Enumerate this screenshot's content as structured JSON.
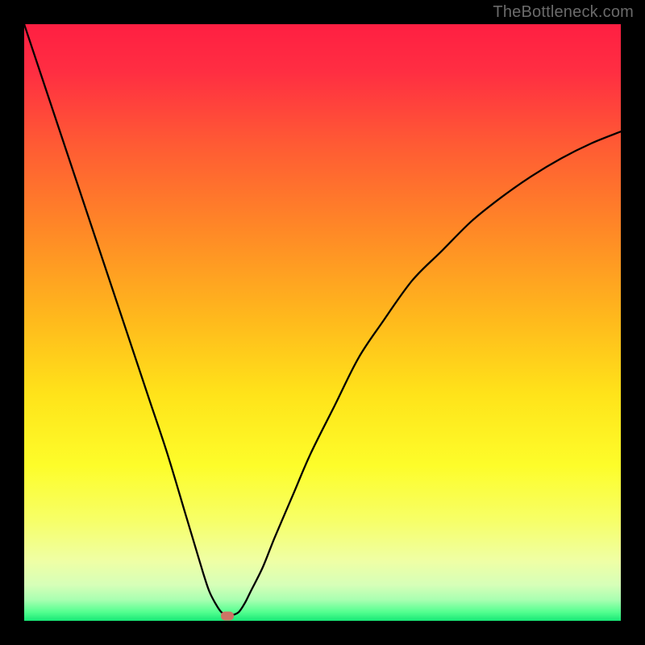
{
  "watermark": {
    "text": "TheBottleneck.com"
  },
  "chart_data": {
    "type": "line",
    "title": "",
    "xlabel": "",
    "ylabel": "",
    "xlim": [
      0,
      100
    ],
    "ylim": [
      0,
      100
    ],
    "grid": false,
    "legend": false,
    "series": [
      {
        "name": "curve",
        "x": [
          0,
          3,
          6,
          9,
          12,
          15,
          18,
          21,
          24,
          27,
          28.5,
          30,
          31,
          32,
          33,
          34,
          35,
          36,
          37,
          38,
          40,
          42,
          45,
          48,
          52,
          56,
          60,
          65,
          70,
          75,
          80,
          85,
          90,
          95,
          100
        ],
        "y": [
          100,
          91,
          82,
          73,
          64,
          55,
          46,
          37,
          28,
          18,
          13,
          8,
          5,
          3,
          1.5,
          1,
          1,
          1.5,
          3,
          5,
          9,
          14,
          21,
          28,
          36,
          44,
          50,
          57,
          62,
          67,
          71,
          74.5,
          77.5,
          80,
          82
        ],
        "color": "#000000",
        "stroke_width": 2.3
      }
    ],
    "marker": {
      "x": 34,
      "y": 0.8,
      "color": "#cd7465"
    },
    "background_gradient": {
      "stops": [
        {
          "offset": 0,
          "color": "#ff1f42"
        },
        {
          "offset": 0.08,
          "color": "#ff2e42"
        },
        {
          "offset": 0.2,
          "color": "#ff5a34"
        },
        {
          "offset": 0.35,
          "color": "#ff8a26"
        },
        {
          "offset": 0.5,
          "color": "#ffbb1c"
        },
        {
          "offset": 0.62,
          "color": "#ffe31a"
        },
        {
          "offset": 0.74,
          "color": "#fdfd2a"
        },
        {
          "offset": 0.83,
          "color": "#f7ff66"
        },
        {
          "offset": 0.9,
          "color": "#efffa5"
        },
        {
          "offset": 0.94,
          "color": "#d6ffb8"
        },
        {
          "offset": 0.965,
          "color": "#a8ffb1"
        },
        {
          "offset": 0.985,
          "color": "#55ff90"
        },
        {
          "offset": 1.0,
          "color": "#17e876"
        }
      ]
    }
  }
}
